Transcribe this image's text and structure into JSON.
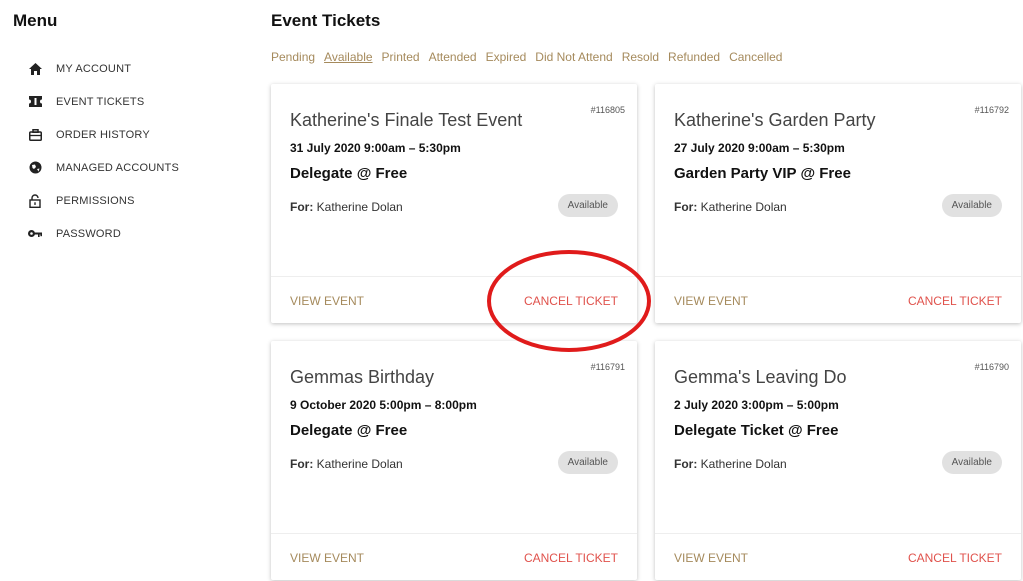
{
  "sidebar": {
    "title": "Menu",
    "items": [
      {
        "label": "MY ACCOUNT",
        "icon": "home-icon"
      },
      {
        "label": "EVENT TICKETS",
        "icon": "ticket-icon"
      },
      {
        "label": "ORDER HISTORY",
        "icon": "briefcase-icon"
      },
      {
        "label": "MANAGED ACCOUNTS",
        "icon": "globe-icon"
      },
      {
        "label": "PERMISSIONS",
        "icon": "lock-icon"
      },
      {
        "label": "PASSWORD",
        "icon": "key-icon"
      }
    ]
  },
  "main": {
    "title": "Event Tickets",
    "tabs": [
      {
        "label": "Pending"
      },
      {
        "label": "Available",
        "active": true
      },
      {
        "label": "Printed"
      },
      {
        "label": "Attended"
      },
      {
        "label": "Expired"
      },
      {
        "label": "Did Not Attend"
      },
      {
        "label": "Resold"
      },
      {
        "label": "Refunded"
      },
      {
        "label": "Cancelled"
      }
    ],
    "cards": [
      {
        "ref": "#116805",
        "title": "Katherine's Finale Test Event",
        "date": "31 July 2020 9:00am – 5:30pm",
        "ticket": "Delegate @ Free",
        "for_label": "For:",
        "for_name": "Katherine Dolan",
        "status": "Available",
        "view_label": "VIEW EVENT",
        "cancel_label": "CANCEL TICKET"
      },
      {
        "ref": "#116792",
        "title": "Katherine's Garden Party",
        "date": "27 July 2020 9:00am – 5:30pm",
        "ticket": "Garden Party VIP @ Free",
        "for_label": "For:",
        "for_name": "Katherine Dolan",
        "status": "Available",
        "view_label": "VIEW EVENT",
        "cancel_label": "CANCEL TICKET"
      },
      {
        "ref": "#116791",
        "title": "Gemmas Birthday",
        "date": "9 October 2020 5:00pm – 8:00pm",
        "ticket": "Delegate @ Free",
        "for_label": "For:",
        "for_name": "Katherine Dolan",
        "status": "Available",
        "view_label": "VIEW EVENT",
        "cancel_label": "CANCEL TICKET"
      },
      {
        "ref": "#116790",
        "title": "Gemma's Leaving Do",
        "date": "2 July 2020 3:00pm – 5:00pm",
        "ticket": "Delegate Ticket @ Free",
        "for_label": "For:",
        "for_name": "Katherine Dolan",
        "status": "Available",
        "view_label": "VIEW EVENT",
        "cancel_label": "CANCEL TICKET"
      }
    ]
  },
  "colors": {
    "accent": "#a58a5c",
    "cancel": "#e0524c",
    "annotation": "#e01b1b",
    "badge_bg": "#e1e1e1"
  }
}
